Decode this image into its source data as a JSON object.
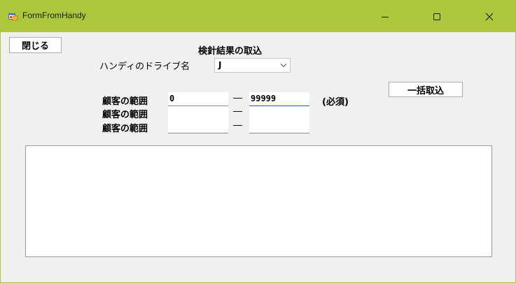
{
  "window": {
    "title": "FormFromHandy",
    "accent": "#acc73b"
  },
  "buttons": {
    "close_label": "閉じる",
    "bulk_import_label": "一括取込"
  },
  "form": {
    "heading": "検針結果の取込",
    "drive_label": "ハンディのドライブ名",
    "drive_value": "J",
    "range_label": "顧客の範囲",
    "dash": "―",
    "required_note": "(必須)",
    "ranges": [
      {
        "from": "0",
        "to": "99999"
      },
      {
        "from": "",
        "to": ""
      },
      {
        "from": "",
        "to": ""
      }
    ]
  },
  "icons": {
    "app": "app-form-icon",
    "minimize": "minimize-icon",
    "maximize": "maximize-icon",
    "close": "close-icon",
    "dropdown": "chevron-down-icon"
  }
}
